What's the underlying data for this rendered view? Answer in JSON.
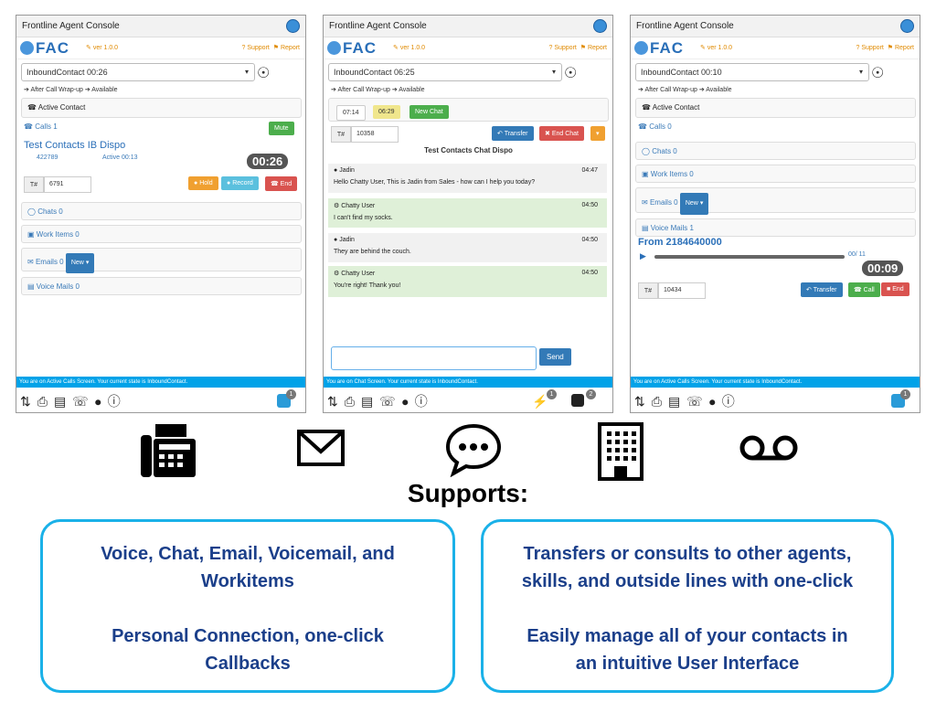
{
  "app": {
    "title": "Frontline Agent Console",
    "logo": "FAC",
    "version": "ver 1.0.0",
    "support": "Support",
    "report": "Report",
    "after_call": "After Call Wrap-up",
    "available": "Available"
  },
  "panel1": {
    "state": "InboundContact 00:26",
    "active_contact": "Active Contact",
    "calls": "Calls 1",
    "mute": "Mute",
    "contact_name": "Test Contacts IB Dispo",
    "contact_id": "422789",
    "active_time": "Active 00:13",
    "timer": "00:26",
    "t_label": "T#",
    "t_value": "6791",
    "hold": "Hold",
    "record": "Record",
    "end": "End",
    "chats": "Chats 0",
    "work_items": "Work Items 0",
    "emails": "Emails 0",
    "new": "New",
    "voice_mails": "Voice Mails 0",
    "status": "You are on Active Calls Screen.   Your current state is InboundContact."
  },
  "panel2": {
    "state": "InboundContact 06:25",
    "t1": "07:14",
    "t2": "06:29",
    "new_chat": "New Chat",
    "t_label": "T#",
    "t_value": "10358",
    "transfer": "Transfer",
    "end_chat": "End Chat",
    "chat_title": "Test Contacts Chat Dispo",
    "messages": [
      {
        "sender": "Jadin",
        "time": "04:47",
        "text": "Hello Chatty User, This is Jadin from Sales - how can I help you today?"
      },
      {
        "sender": "Chatty User",
        "time": "04:50",
        "text": "I can't find my socks."
      },
      {
        "sender": "Jadin",
        "time": "04:50",
        "text": "They are behind the couch."
      },
      {
        "sender": "Chatty User",
        "time": "04:50",
        "text": "You're right! Thank you!"
      }
    ],
    "send": "Send",
    "status": "You are on Chat Screen.   Your current state is InboundContact.",
    "badge1": "1",
    "badge2": "2"
  },
  "panel3": {
    "state": "InboundContact 00:10",
    "active_contact": "Active Contact",
    "calls": "Calls 0",
    "chats": "Chats 0",
    "work_items": "Work Items 0",
    "emails": "Emails 0",
    "new": "New",
    "voice_mails": "Voice Mails 1",
    "from": "From 2184640000",
    "progress": "00/ 11",
    "timer": "00:09",
    "t_label": "T#",
    "t_value": "10434",
    "transfer": "Transfer",
    "call": "Call",
    "end": "End",
    "status": "You are on Active Calls Screen.   Your current state is InboundContact."
  },
  "badge": "1",
  "supports": "Supports:",
  "box1": {
    "line1": "Voice, Chat, Email, Voicemail, and",
    "line2": "Workitems",
    "line3": "Personal Connection, one-click",
    "line4": "Callbacks"
  },
  "box2": {
    "line1": "Transfers or consults to other agents,",
    "line2": "skills, and outside lines with one-click",
    "line3": "Easily manage all of your contacts in",
    "line4": "an intuitive User Interface"
  },
  "colors": {
    "accent": "#1ab1e8",
    "heading": "#1b3f8a",
    "status_bar": "#00a2e8"
  }
}
